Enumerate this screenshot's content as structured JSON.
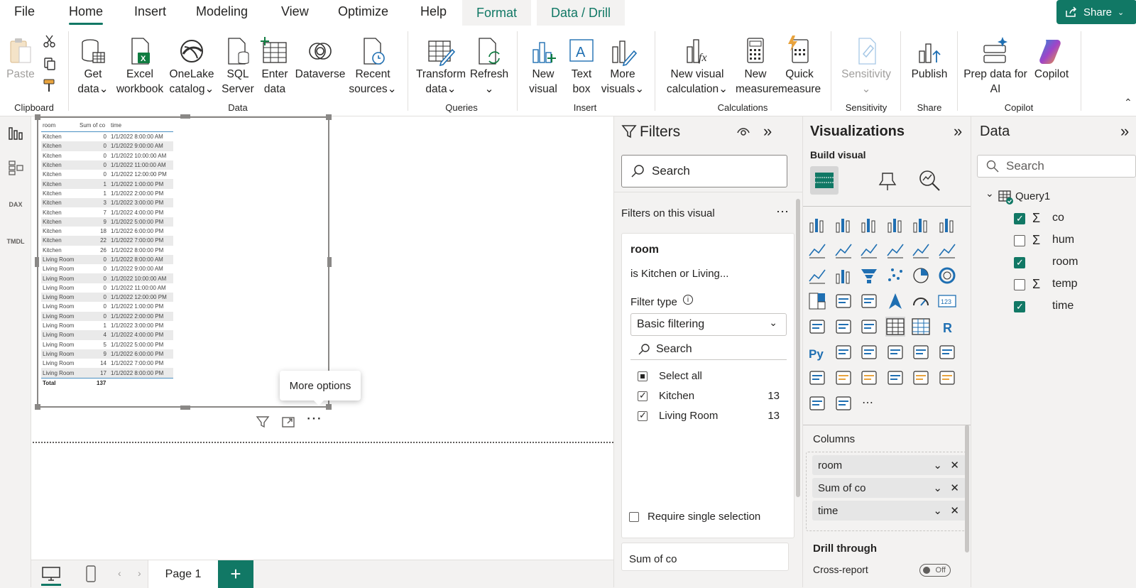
{
  "tabs": [
    "File",
    "Home",
    "Insert",
    "Modeling",
    "View",
    "Optimize",
    "Help",
    "Format",
    "Data / Drill"
  ],
  "share_label": "Share",
  "ribbon": {
    "clipboard": {
      "paste": "Paste",
      "group": "Clipboard"
    },
    "data": {
      "get_data": [
        "Get",
        "data"
      ],
      "excel": [
        "Excel",
        "workbook"
      ],
      "onelake": [
        "OneLake",
        "catalog"
      ],
      "sql": [
        "SQL",
        "Server"
      ],
      "enter": [
        "Enter",
        "data"
      ],
      "dataverse": "Dataverse",
      "recent": [
        "Recent",
        "sources"
      ],
      "group": "Data"
    },
    "queries": {
      "transform": [
        "Transform",
        "data"
      ],
      "refresh": "Refresh",
      "group": "Queries"
    },
    "insert": {
      "new_visual": [
        "New",
        "visual"
      ],
      "text_box": [
        "Text",
        "box"
      ],
      "more_visuals": [
        "More",
        "visuals"
      ],
      "group": "Insert"
    },
    "calculations": {
      "new_visual_calc": [
        "New visual",
        "calculation"
      ],
      "new_measure": [
        "New",
        "measure"
      ],
      "quick_measure": [
        "Quick",
        "measure"
      ],
      "group": "Calculations"
    },
    "sensitivity": {
      "label": "Sensitivity",
      "group": "Sensitivity"
    },
    "share": {
      "publish": "Publish",
      "group": "Share"
    },
    "copilot": {
      "prep": [
        "Prep data for",
        "AI"
      ],
      "copilot": "Copilot",
      "group": "Copilot"
    }
  },
  "rail": {
    "dax": "DAX",
    "tmdl": "TMDL"
  },
  "table_visual": {
    "headers": [
      "room",
      "Sum of co",
      "time"
    ],
    "rows": [
      [
        "Kitchen",
        "0",
        "1/1/2022 8:00:00 AM"
      ],
      [
        "Kitchen",
        "0",
        "1/1/2022 9:00:00 AM"
      ],
      [
        "Kitchen",
        "0",
        "1/1/2022 10:00:00 AM"
      ],
      [
        "Kitchen",
        "0",
        "1/1/2022 11:00:00 AM"
      ],
      [
        "Kitchen",
        "0",
        "1/1/2022 12:00:00 PM"
      ],
      [
        "Kitchen",
        "1",
        "1/1/2022 1:00:00 PM"
      ],
      [
        "Kitchen",
        "1",
        "1/1/2022 2:00:00 PM"
      ],
      [
        "Kitchen",
        "3",
        "1/1/2022 3:00:00 PM"
      ],
      [
        "Kitchen",
        "7",
        "1/1/2022 4:00:00 PM"
      ],
      [
        "Kitchen",
        "9",
        "1/1/2022 5:00:00 PM"
      ],
      [
        "Kitchen",
        "18",
        "1/1/2022 6:00:00 PM"
      ],
      [
        "Kitchen",
        "22",
        "1/1/2022 7:00:00 PM"
      ],
      [
        "Kitchen",
        "26",
        "1/1/2022 8:00:00 PM"
      ],
      [
        "Living Room",
        "0",
        "1/1/2022 8:00:00 AM"
      ],
      [
        "Living Room",
        "0",
        "1/1/2022 9:00:00 AM"
      ],
      [
        "Living Room",
        "0",
        "1/1/2022 10:00:00 AM"
      ],
      [
        "Living Room",
        "0",
        "1/1/2022 11:00:00 AM"
      ],
      [
        "Living Room",
        "0",
        "1/1/2022 12:00:00 PM"
      ],
      [
        "Living Room",
        "0",
        "1/1/2022 1:00:00 PM"
      ],
      [
        "Living Room",
        "0",
        "1/1/2022 2:00:00 PM"
      ],
      [
        "Living Room",
        "1",
        "1/1/2022 3:00:00 PM"
      ],
      [
        "Living Room",
        "4",
        "1/1/2022 4:00:00 PM"
      ],
      [
        "Living Room",
        "5",
        "1/1/2022 5:00:00 PM"
      ],
      [
        "Living Room",
        "9",
        "1/1/2022 6:00:00 PM"
      ],
      [
        "Living Room",
        "14",
        "1/1/2022 7:00:00 PM"
      ],
      [
        "Living Room",
        "17",
        "1/1/2022 8:00:00 PM"
      ]
    ],
    "total_label": "Total",
    "total_value": "137"
  },
  "tooltip": "More options",
  "page_tab": "Page 1",
  "filters": {
    "title": "Filters",
    "search_placeholder": "Search",
    "section": "Filters on this visual",
    "card_field": "room",
    "card_summary": "is Kitchen or Living...",
    "filter_type_label": "Filter type",
    "filter_type_value": "Basic filtering",
    "inner_search": "Search",
    "select_all": "Select all",
    "items": [
      {
        "label": "Kitchen",
        "count": "13"
      },
      {
        "label": "Living Room",
        "count": "13"
      }
    ],
    "require_single": "Require single selection",
    "next_card": "Sum of co"
  },
  "visualizations": {
    "title": "Visualizations",
    "build_visual": "Build visual",
    "columns_label": "Columns",
    "wells": [
      "room",
      "Sum of co",
      "time"
    ],
    "drill_through": "Drill through",
    "cross_report": "Cross-report",
    "toggle": "Off"
  },
  "data_pane": {
    "title": "Data",
    "search_placeholder": "Search",
    "table": "Query1",
    "fields": [
      {
        "name": "co",
        "sigma": true,
        "checked": true
      },
      {
        "name": "hum",
        "sigma": true,
        "checked": false
      },
      {
        "name": "room",
        "sigma": false,
        "checked": true
      },
      {
        "name": "temp",
        "sigma": true,
        "checked": false
      },
      {
        "name": "time",
        "sigma": false,
        "checked": true
      }
    ]
  },
  "colors": {
    "accent": "#117865",
    "chart_blue": "#1f6fb2",
    "chart_orange": "#e8a33d"
  }
}
